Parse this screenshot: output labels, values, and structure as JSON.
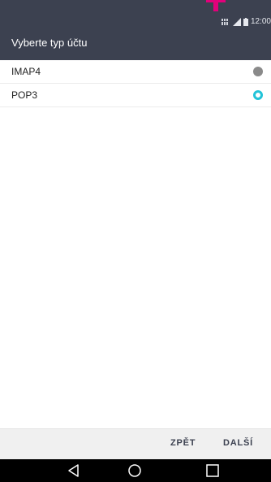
{
  "status_bar": {
    "time": "12:00",
    "icons": [
      "carrier-logo-icon",
      "network-icon",
      "signal-icon",
      "battery-icon"
    ]
  },
  "header": {
    "title": "Vyberte typ účtu"
  },
  "account_types": [
    {
      "label": "IMAP4",
      "selected": false
    },
    {
      "label": "POP3",
      "selected": true
    }
  ],
  "actions": {
    "back_label": "ZPĚT",
    "next_label": "DALŠÍ"
  },
  "navigation": {
    "icons": [
      "back-triangle-icon",
      "home-circle-icon",
      "recents-square-icon"
    ]
  },
  "colors": {
    "header_background": "#3c4150",
    "accent": "#22c3d8",
    "unselected_radio": "#8a8a8a",
    "carrier_magenta": "#e2007a"
  }
}
